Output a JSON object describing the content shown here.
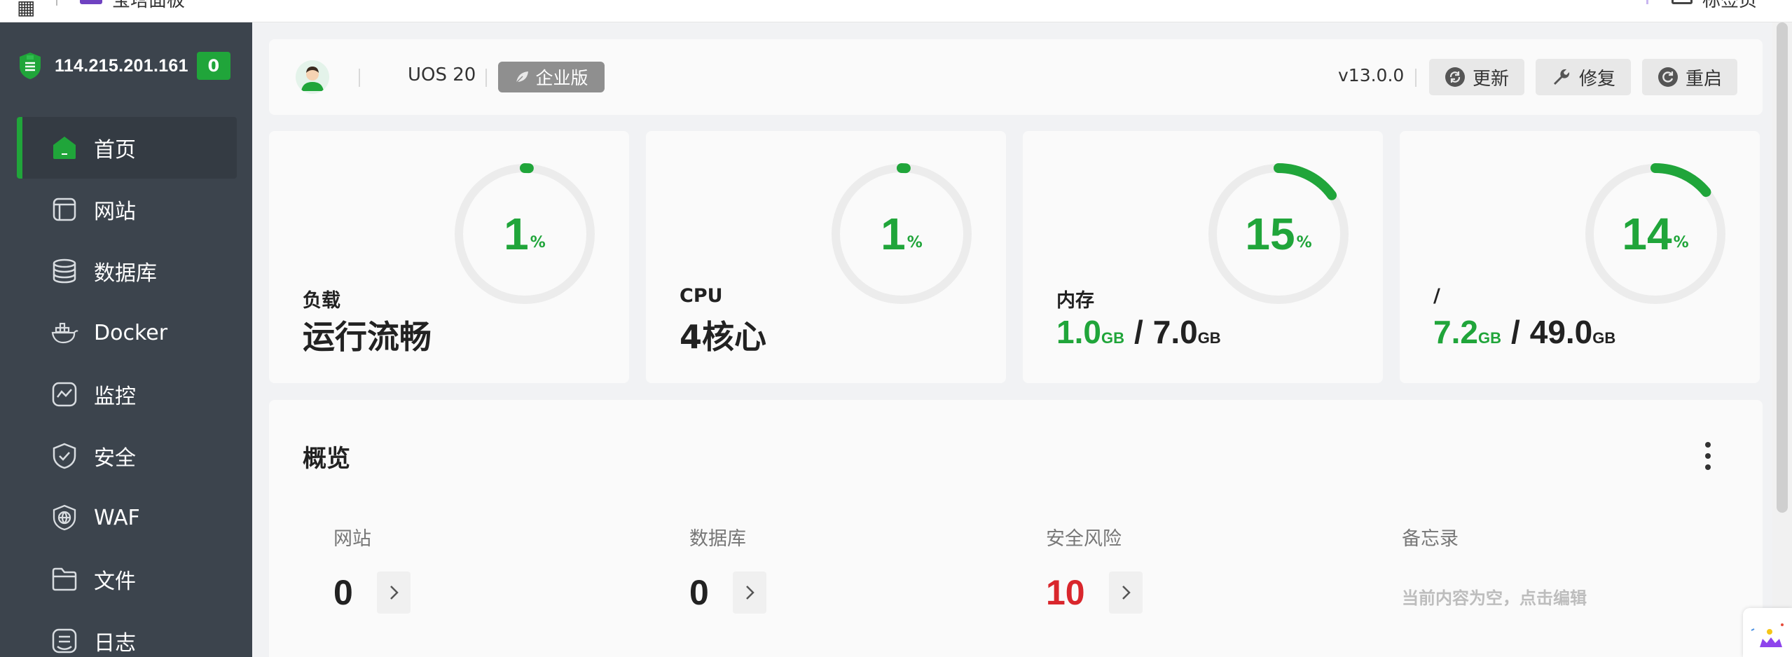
{
  "topbar": {
    "left_text": "宝塔面板",
    "right_text": "标签页"
  },
  "sidebar": {
    "server_ip": "114.215.201.161",
    "alert_count": "0",
    "items": [
      {
        "label": "首页",
        "icon": "home-icon",
        "active": true
      },
      {
        "label": "网站",
        "icon": "website-icon"
      },
      {
        "label": "数据库",
        "icon": "database-icon"
      },
      {
        "label": "Docker",
        "icon": "docker-icon"
      },
      {
        "label": "监控",
        "icon": "monitor-icon"
      },
      {
        "label": "安全",
        "icon": "shield-icon"
      },
      {
        "label": "WAF",
        "icon": "waf-icon"
      },
      {
        "label": "文件",
        "icon": "folder-icon"
      },
      {
        "label": "日志",
        "icon": "log-icon"
      }
    ]
  },
  "header": {
    "os": "UOS 20",
    "edition": "企业版",
    "version": "v13.0.0",
    "update_label": "更新",
    "repair_label": "修复",
    "restart_label": "重启"
  },
  "stats": [
    {
      "label": "负载",
      "value": "1",
      "unit": "%",
      "percent": 1,
      "sub": "运行流畅"
    },
    {
      "label": "CPU",
      "value": "1",
      "unit": "%",
      "percent": 1,
      "sub": "4核心"
    },
    {
      "label": "内存",
      "value": "15",
      "unit": "%",
      "percent": 15,
      "used": "1.0",
      "total": "7.0",
      "size_unit": "GB"
    },
    {
      "label": "/",
      "value": "14",
      "unit": "%",
      "percent": 14,
      "used": "7.2",
      "total": "49.0",
      "size_unit": "GB"
    }
  ],
  "overview": {
    "title": "概览",
    "items": [
      {
        "label": "网站",
        "value": "0"
      },
      {
        "label": "数据库",
        "value": "0"
      },
      {
        "label": "安全风险",
        "value": "10"
      },
      {
        "label": "备忘录",
        "memo": "当前内容为空，点击编辑"
      }
    ]
  },
  "colors": {
    "accent": "#20a53a",
    "danger": "#d9262c",
    "sidebar": "#3c444d"
  }
}
